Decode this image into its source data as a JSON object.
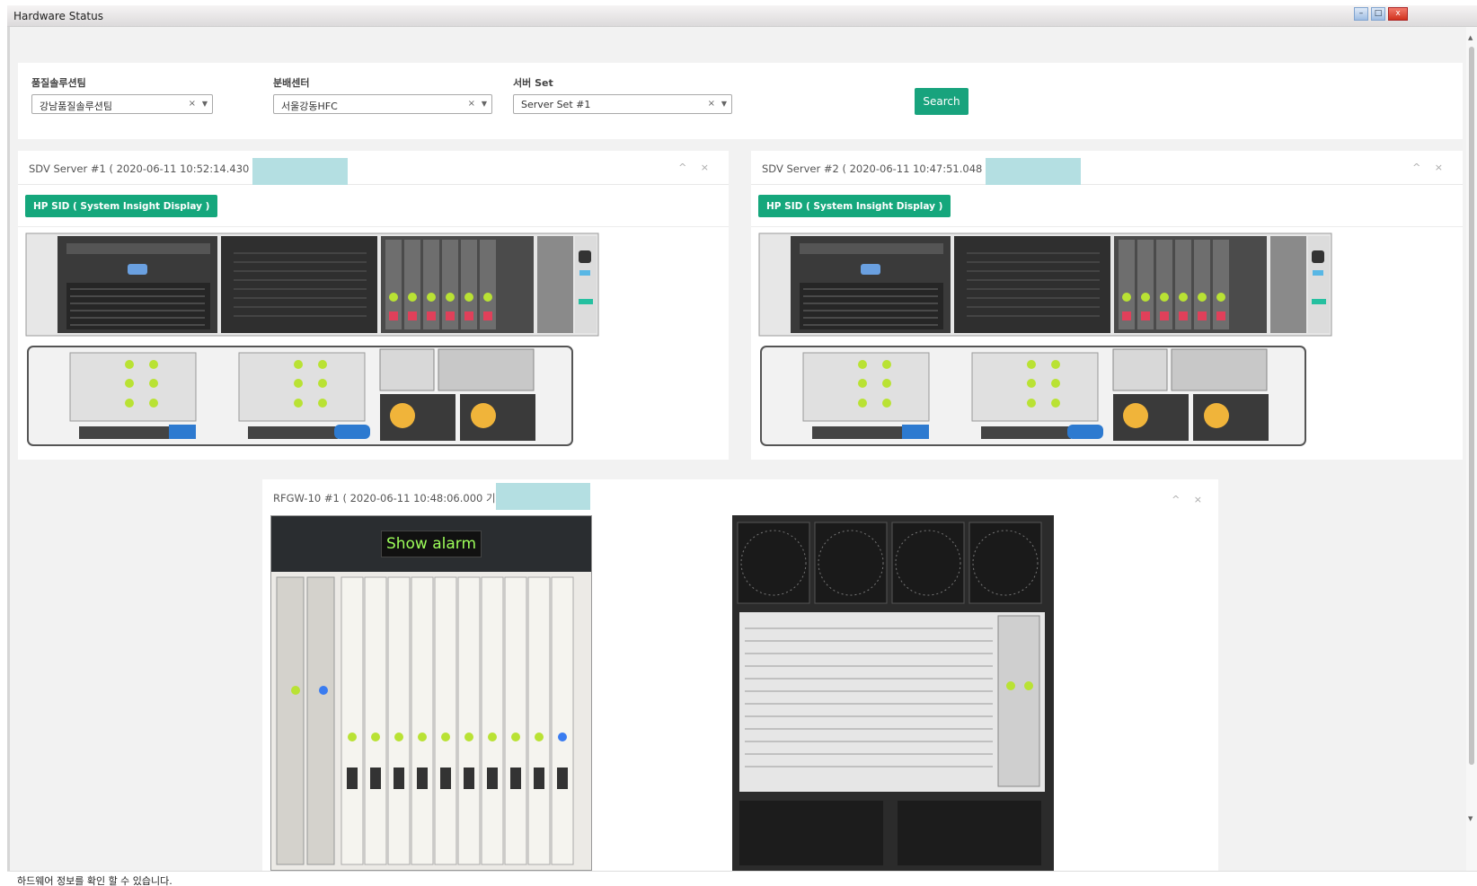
{
  "window": {
    "title": "Hardware Status",
    "minimize_label": "–",
    "maximize_label": "□",
    "close_label": "x"
  },
  "filters": [
    {
      "label": "품질솔루션팀",
      "value": "강남품질솔루션팀",
      "clear": "×",
      "arrow": "▼"
    },
    {
      "label": "분배센터",
      "value": "서울강동HFC",
      "clear": "×",
      "arrow": "▼"
    },
    {
      "label": "서버 Set",
      "value": "Server Set #1",
      "clear": "×",
      "arrow": "▼"
    }
  ],
  "search_label": "Search",
  "panels": {
    "sdv1": {
      "title": "SDV Server #1 ( 2020-06-11 10:52:14.430 기준",
      "sid_button": "HP SID ( System Insight Display )",
      "tools": "^ ×"
    },
    "sdv2": {
      "title": "SDV Server #2 ( 2020-06-11 10:47:51.048 기준",
      "sid_button": "HP SID ( System Insight Display )",
      "tools": "^ ×"
    },
    "rfgw": {
      "title": "RFGW-10 #1 ( 2020-06-11 10:48:06.000 기준 )",
      "show_alarm": "Show alarm",
      "tools": "^ ×"
    }
  },
  "status_text": "하드웨어 정보를 확인 할 수 있습니다.",
  "colors": {
    "accent_green": "#18a37d",
    "highlight": "#b4dfe2",
    "led_green": "#b9e234",
    "led_red": "#e0405a",
    "led_blue": "#3a7cf0"
  }
}
